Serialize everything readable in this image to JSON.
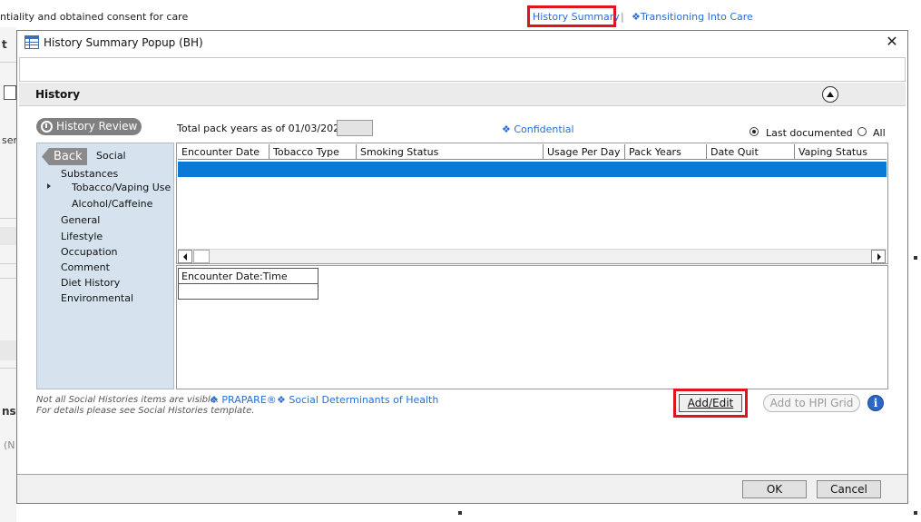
{
  "background": {
    "consent_text": "ntiality and obtained consent for care",
    "history_summary_link": "History Summary",
    "separator": "|",
    "transitioning_link": "Transitioning Into Care",
    "frag_t": "t",
    "frag_sen": "sen",
    "frag_ns": "ns",
    "frag_n": "(N"
  },
  "popup": {
    "title": "History Summary Popup (BH)",
    "close_label": "✕",
    "section_title": "History",
    "history_review_label": "History Review",
    "pack_years_label": "Total pack years as of 01/03/2022:",
    "confidential_label": "Confidential",
    "radio_last_label": "Last documented",
    "radio_all_label": "All",
    "nav": {
      "back_label": "Back",
      "current": "Social",
      "items": [
        {
          "label": "Substances"
        },
        {
          "label": "Tobacco/Vaping Use"
        },
        {
          "label": "Alcohol/Caffeine"
        },
        {
          "label": "General"
        },
        {
          "label": "Lifestyle"
        },
        {
          "label": "Occupation"
        },
        {
          "label": "Comment"
        },
        {
          "label": "Diet History"
        },
        {
          "label": "Environmental"
        }
      ]
    },
    "grid": {
      "columns": [
        "Encounter Date",
        "Tobacco Type",
        "Smoking Status",
        "Usage Per Day",
        "Pack Years",
        "Date Quit",
        "Vaping Status"
      ]
    },
    "subgrid": {
      "column": "Encounter Date:Time"
    },
    "note_line1": "Not all Social Histories items are visible.",
    "prapare_link": "PRAPARE®",
    "sdoh_link": "Social Determinants of Health",
    "note_line2": "For details please see Social Histories template.",
    "add_edit_label": "Add/Edit",
    "add_hpi_label": "Add to HPI Grid",
    "info_label": "i",
    "ok_label": "OK",
    "cancel_label": "Cancel"
  },
  "colors": {
    "link": "#2a6ed6",
    "highlight_box": "#e0141e",
    "selected_row": "#0a7ad9",
    "nav_bg": "#d6e3ef"
  }
}
